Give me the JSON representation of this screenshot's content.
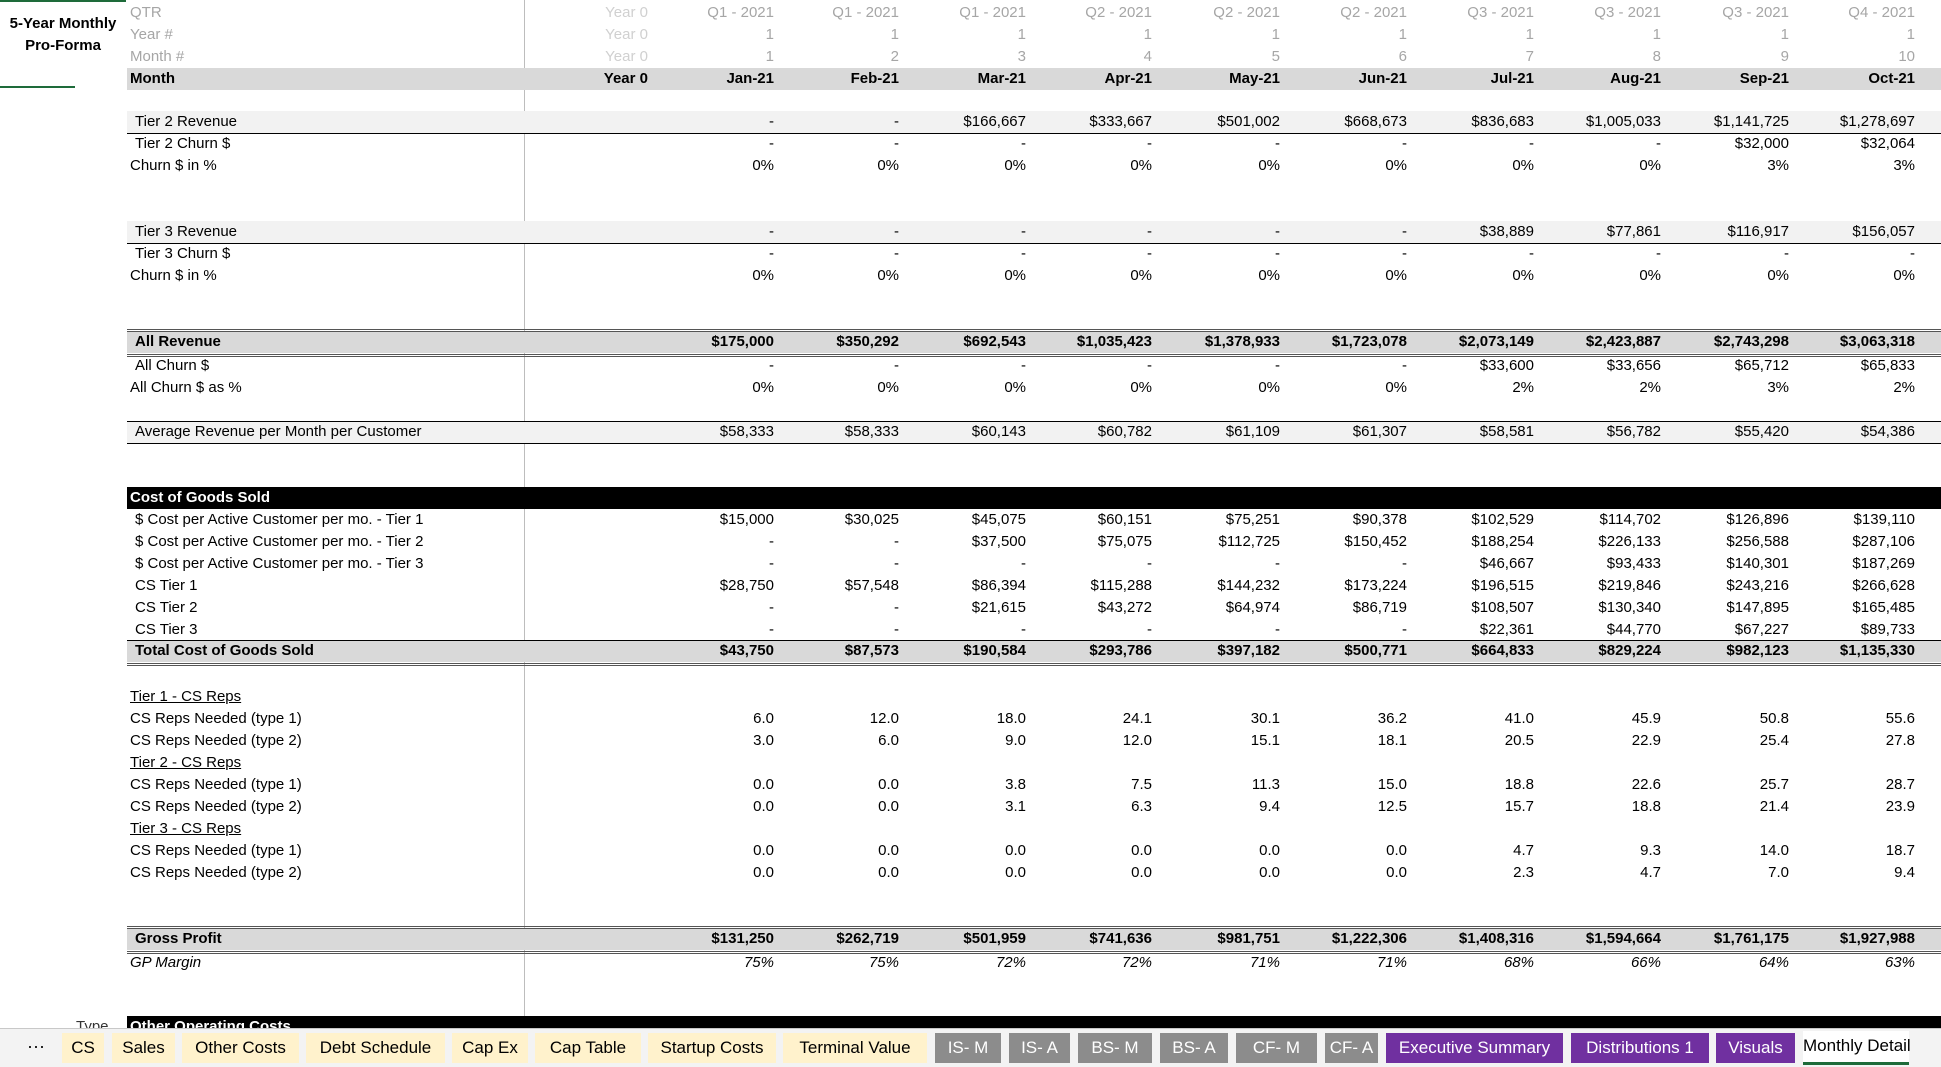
{
  "sheet_title": [
    "5-Year Monthly",
    "Pro-Forma"
  ],
  "header_rows": [
    {
      "label": "QTR",
      "cells": [
        "Year 0",
        "Q1 - 2021",
        "Q1 - 2021",
        "Q1 - 2021",
        "Q2 - 2021",
        "Q2 - 2021",
        "Q2 - 2021",
        "Q3 - 2021",
        "Q3 - 2021",
        "Q3 - 2021",
        "Q4 - 2021"
      ]
    },
    {
      "label": "Year #",
      "cells": [
        "Year 0",
        "1",
        "1",
        "1",
        "1",
        "1",
        "1",
        "1",
        "1",
        "1",
        "1"
      ]
    },
    {
      "label": "Month #",
      "cells": [
        "Year 0",
        "1",
        "2",
        "3",
        "4",
        "5",
        "6",
        "7",
        "8",
        "9",
        "10"
      ]
    }
  ],
  "month_row": {
    "label": "Month",
    "cells": [
      "Year 0",
      "Jan-21",
      "Feb-21",
      "Mar-21",
      "Apr-21",
      "May-21",
      "Jun-21",
      "Jul-21",
      "Aug-21",
      "Sep-21",
      "Oct-21"
    ]
  },
  "rows": {
    "t2rev": {
      "label": "Tier 2 Revenue",
      "cells": [
        "",
        "-",
        "-",
        "$166,667",
        "$333,667",
        "$501,002",
        "$668,673",
        "$836,683",
        "$1,005,033",
        "$1,141,725",
        "$1,278,697"
      ]
    },
    "t2churn": {
      "label": "Tier 2 Churn $",
      "cells": [
        "",
        "-",
        "-",
        "-",
        "-",
        "-",
        "-",
        "-",
        "-",
        "$32,000",
        "$32,064"
      ]
    },
    "t2pct": {
      "label": "Churn $ in %",
      "cells": [
        "",
        "0%",
        "0%",
        "0%",
        "0%",
        "0%",
        "0%",
        "0%",
        "0%",
        "3%",
        "3%"
      ]
    },
    "t3rev": {
      "label": "Tier 3 Revenue",
      "cells": [
        "",
        "-",
        "-",
        "-",
        "-",
        "-",
        "-",
        "$38,889",
        "$77,861",
        "$116,917",
        "$156,057"
      ]
    },
    "t3churn": {
      "label": "Tier 3 Churn $",
      "cells": [
        "",
        "-",
        "-",
        "-",
        "-",
        "-",
        "-",
        "-",
        "-",
        "-",
        "-"
      ]
    },
    "t3pct": {
      "label": "Churn $ in %",
      "cells": [
        "",
        "0%",
        "0%",
        "0%",
        "0%",
        "0%",
        "0%",
        "0%",
        "0%",
        "0%",
        "0%"
      ]
    },
    "allrev": {
      "label": "All Revenue",
      "cells": [
        "",
        "$175,000",
        "$350,292",
        "$692,543",
        "$1,035,423",
        "$1,378,933",
        "$1,723,078",
        "$2,073,149",
        "$2,423,887",
        "$2,743,298",
        "$3,063,318"
      ]
    },
    "allchurn": {
      "label": "All Churn $",
      "cells": [
        "",
        "-",
        "-",
        "-",
        "-",
        "-",
        "-",
        "$33,600",
        "$33,656",
        "$65,712",
        "$65,833"
      ]
    },
    "allpct": {
      "label": "All Churn $ as %",
      "cells": [
        "",
        "0%",
        "0%",
        "0%",
        "0%",
        "0%",
        "0%",
        "2%",
        "2%",
        "3%",
        "2%"
      ]
    },
    "arpc": {
      "label": "Average Revenue per Month per Customer",
      "cells": [
        "",
        "$58,333",
        "$58,333",
        "$60,143",
        "$60,782",
        "$61,109",
        "$61,307",
        "$58,581",
        "$56,782",
        "$55,420",
        "$54,386"
      ]
    },
    "cogs_hdr": {
      "label": "Cost of Goods Sold",
      "cells": [
        "",
        "",
        "",
        "",
        "",
        "",
        "",
        "",
        "",
        "",
        ""
      ]
    },
    "cpc1": {
      "label": "$ Cost per Active Customer per mo. - Tier 1",
      "cells": [
        "",
        "$15,000",
        "$30,025",
        "$45,075",
        "$60,151",
        "$75,251",
        "$90,378",
        "$102,529",
        "$114,702",
        "$126,896",
        "$139,110"
      ]
    },
    "cpc2": {
      "label": "$ Cost per Active Customer per mo. - Tier 2",
      "cells": [
        "",
        "-",
        "-",
        "$37,500",
        "$75,075",
        "$112,725",
        "$150,452",
        "$188,254",
        "$226,133",
        "$256,588",
        "$287,106"
      ]
    },
    "cpc3": {
      "label": "$ Cost per Active Customer per mo. - Tier 3",
      "cells": [
        "",
        "-",
        "-",
        "-",
        "-",
        "-",
        "-",
        "$46,667",
        "$93,433",
        "$140,301",
        "$187,269"
      ]
    },
    "cs1": {
      "label": "CS Tier 1",
      "cells": [
        "",
        "$28,750",
        "$57,548",
        "$86,394",
        "$115,288",
        "$144,232",
        "$173,224",
        "$196,515",
        "$219,846",
        "$243,216",
        "$266,628"
      ]
    },
    "cs2": {
      "label": "CS Tier 2",
      "cells": [
        "",
        "-",
        "-",
        "$21,615",
        "$43,272",
        "$64,974",
        "$86,719",
        "$108,507",
        "$130,340",
        "$147,895",
        "$165,485"
      ]
    },
    "cs3": {
      "label": "CS Tier 3",
      "cells": [
        "",
        "-",
        "-",
        "-",
        "-",
        "-",
        "-",
        "$22,361",
        "$44,770",
        "$67,227",
        "$89,733"
      ]
    },
    "tcogs": {
      "label": "Total Cost of Goods Sold",
      "cells": [
        "",
        "$43,750",
        "$87,573",
        "$190,584",
        "$293,786",
        "$397,182",
        "$500,771",
        "$664,833",
        "$829,224",
        "$982,123",
        "$1,135,330"
      ]
    },
    "t1hdr": {
      "label": "Tier 1 - CS Reps",
      "cells": [
        "",
        "",
        "",
        "",
        "",
        "",
        "",
        "",
        "",
        "",
        ""
      ]
    },
    "t1r1": {
      "label": "CS Reps Needed (type 1)",
      "cells": [
        "",
        "6.0",
        "12.0",
        "18.0",
        "24.1",
        "30.1",
        "36.2",
        "41.0",
        "45.9",
        "50.8",
        "55.6"
      ]
    },
    "t1r2": {
      "label": "CS Reps Needed (type 2)",
      "cells": [
        "",
        "3.0",
        "6.0",
        "9.0",
        "12.0",
        "15.1",
        "18.1",
        "20.5",
        "22.9",
        "25.4",
        "27.8"
      ]
    },
    "t2hdr": {
      "label": "Tier 2 - CS Reps",
      "cells": [
        "",
        "",
        "",
        "",
        "",
        "",
        "",
        "",
        "",
        "",
        ""
      ]
    },
    "t2r1": {
      "label": "CS Reps Needed (type 1)",
      "cells": [
        "",
        "0.0",
        "0.0",
        "3.8",
        "7.5",
        "11.3",
        "15.0",
        "18.8",
        "22.6",
        "25.7",
        "28.7"
      ]
    },
    "t2r2": {
      "label": "CS Reps Needed (type 2)",
      "cells": [
        "",
        "0.0",
        "0.0",
        "3.1",
        "6.3",
        "9.4",
        "12.5",
        "15.7",
        "18.8",
        "21.4",
        "23.9"
      ]
    },
    "t3hdr": {
      "label": "Tier 3 - CS Reps",
      "cells": [
        "",
        "",
        "",
        "",
        "",
        "",
        "",
        "",
        "",
        "",
        ""
      ]
    },
    "t3r1": {
      "label": "CS Reps Needed (type 1)",
      "cells": [
        "",
        "0.0",
        "0.0",
        "0.0",
        "0.0",
        "0.0",
        "0.0",
        "4.7",
        "9.3",
        "14.0",
        "18.7"
      ]
    },
    "t3r2": {
      "label": "CS Reps Needed (type 2)",
      "cells": [
        "",
        "0.0",
        "0.0",
        "0.0",
        "0.0",
        "0.0",
        "0.0",
        "2.3",
        "4.7",
        "7.0",
        "9.4"
      ]
    },
    "gp": {
      "label": "Gross Profit",
      "cells": [
        "",
        "$131,250",
        "$262,719",
        "$501,959",
        "$741,636",
        "$981,751",
        "$1,222,306",
        "$1,408,316",
        "$1,594,664",
        "$1,761,175",
        "$1,927,988"
      ]
    },
    "gpm": {
      "label": "GP Margin",
      "cells": [
        "",
        "75%",
        "75%",
        "72%",
        "72%",
        "71%",
        "71%",
        "68%",
        "66%",
        "64%",
        "63%"
      ]
    },
    "ooc": {
      "label": "Other Operating Costs",
      "cells": [
        "",
        "",
        "",
        "",
        "",
        "",
        "",
        "",
        "",
        "",
        ""
      ]
    }
  },
  "partial_left_label": "Type",
  "tabs": [
    {
      "label": "CS",
      "style": "y"
    },
    {
      "label": "Sales",
      "style": "y"
    },
    {
      "label": "Other Costs",
      "style": "y"
    },
    {
      "label": "Debt Schedule",
      "style": "y"
    },
    {
      "label": "Cap Ex",
      "style": "y"
    },
    {
      "label": "Cap Table",
      "style": "y"
    },
    {
      "label": "Startup Costs",
      "style": "y"
    },
    {
      "label": "Terminal Value",
      "style": "y"
    },
    {
      "label": "IS- M",
      "style": "g"
    },
    {
      "label": "IS- A",
      "style": "g"
    },
    {
      "label": "BS- M",
      "style": "g"
    },
    {
      "label": "BS- A",
      "style": "g"
    },
    {
      "label": "CF- M",
      "style": "g"
    },
    {
      "label": "CF- A",
      "style": "g"
    },
    {
      "label": "Executive Summary",
      "style": "p"
    },
    {
      "label": "Distributions 1",
      "style": "p"
    },
    {
      "label": "Visuals",
      "style": "p"
    },
    {
      "label": "Monthly Detail",
      "style": "act"
    }
  ],
  "more_tabs_glyph": "···",
  "colors": {
    "tab_yellow": "#fff2cc",
    "tab_gray": "#8c8c8c",
    "tab_purple": "#7030a0",
    "accent_green": "#1e6b3a"
  }
}
